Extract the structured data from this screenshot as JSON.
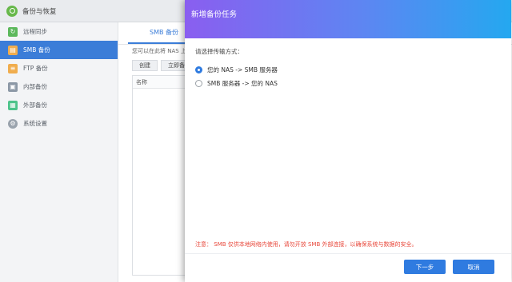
{
  "app": {
    "title": "备份与恢复"
  },
  "sidebar": {
    "items": [
      {
        "label": "远程同步",
        "icon": "sync-icon",
        "color": "#5cb85c"
      },
      {
        "label": "SMB 备份",
        "icon": "smb-backup-icon",
        "color": "#f0ad4e"
      },
      {
        "label": "FTP 备份",
        "icon": "ftp-backup-icon",
        "color": "#f0ad4e"
      },
      {
        "label": "内部备份",
        "icon": "internal-backup-icon",
        "color": "#8c98a6"
      },
      {
        "label": "外部备份",
        "icon": "external-backup-icon",
        "color": "#4cc38a"
      },
      {
        "label": "系统设置",
        "icon": "gear-icon",
        "color": "#9aa3ad"
      }
    ],
    "active_index": 1
  },
  "content": {
    "tab": "SMB 备份",
    "description": "您可以在此将 NAS 上",
    "buttons": {
      "create": "创建",
      "backup_now": "立即备"
    },
    "table": {
      "column_name": "名称"
    }
  },
  "dialog": {
    "title": "新增备份任务",
    "prompt": "请选择传输方式：",
    "options": [
      {
        "label": "您的 NAS -> SMB 服务器",
        "checked": true
      },
      {
        "label": "SMB 服务器 -> 您的 NAS",
        "checked": false
      }
    ],
    "notice": "注意： SMB 仅供本地网络内使用，请勿开放 SMB 外部连接，以确保系统与数据的安全。",
    "next_button": "下一步",
    "cancel_button": "取消"
  },
  "colors": {
    "accent": "#2f7be0",
    "sidebar_active": "#3b7dd8",
    "notice": "#e8483b"
  }
}
